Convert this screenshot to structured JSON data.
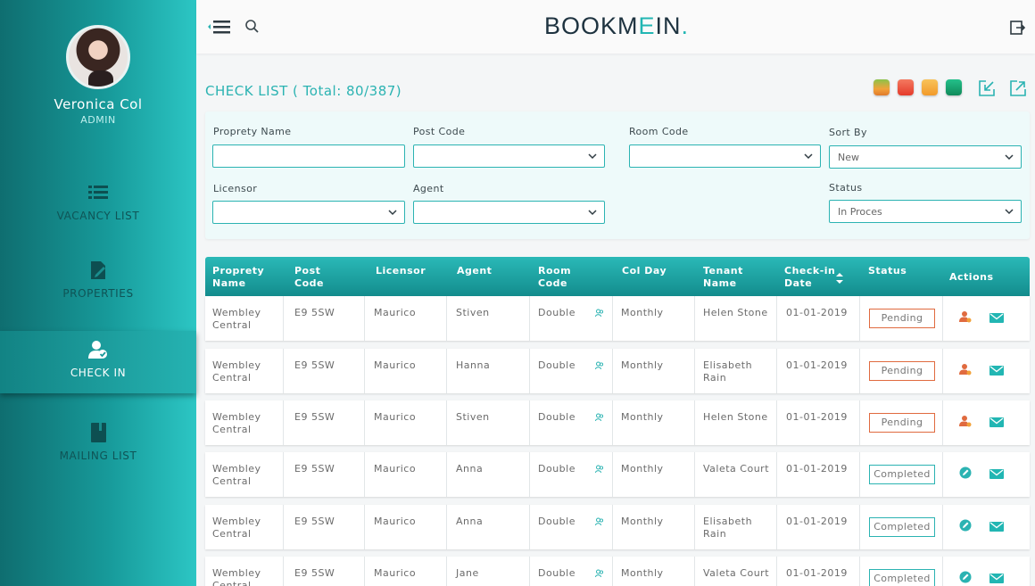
{
  "user": {
    "name": "Veronica Col",
    "role": "ADMIN"
  },
  "nav": [
    {
      "label": "VACANCY LIST",
      "icon": "list-icon"
    },
    {
      "label": "PROPERTIES",
      "icon": "edit-document-icon"
    },
    {
      "label": "CHECK IN",
      "icon": "user-check-icon",
      "active": true
    },
    {
      "label": "MAILING LIST",
      "icon": "book-icon"
    }
  ],
  "brand": {
    "prefix": "BOOKM",
    "accent": "E",
    "suffix": "IN",
    "dot": "."
  },
  "page": {
    "title": "CHECK LIST ( Total: 80/387)"
  },
  "color_filters": [
    "#f2a23a",
    "#f0533a",
    "#f5a93d",
    "#1aa57c"
  ],
  "colors": {
    "accent": "#2bb3b2",
    "pending": "#e06a3f",
    "mail": "#22b6b3",
    "sidebar_dark": "#0f6e70"
  },
  "filters": {
    "property_name": {
      "label": "Proprety Name",
      "value": ""
    },
    "post_code": {
      "label": "Post Code",
      "value": ""
    },
    "room_code": {
      "label": "Room Code",
      "value": ""
    },
    "sort_by": {
      "label": "Sort By",
      "value": "New"
    },
    "licensor": {
      "label": "Licensor",
      "value": ""
    },
    "agent": {
      "label": "Agent",
      "value": ""
    },
    "status": {
      "label": "Status",
      "value": "In Proces"
    }
  },
  "table": {
    "headers": [
      "Proprety\nName",
      "Post\nCode",
      "Licensor",
      "Agent",
      "Room\nCode",
      "Col Day",
      "Tenant\nName",
      "Check-in\nDate",
      "Status",
      "Actions"
    ],
    "rows": [
      {
        "property": "Wembley\nCentral",
        "post_code": "E9 5SW",
        "licensor": "Maurico",
        "agent": "Stiven",
        "room": "Double",
        "col_day": "Monthly",
        "tenant": "Helen Stone",
        "date": "01-01-2019",
        "status": "Pending"
      },
      {
        "property": "Wembley\nCentral",
        "post_code": "E9 5SW",
        "licensor": "Maurico",
        "agent": "Hanna",
        "room": "Double",
        "col_day": "Monthly",
        "tenant": "Elisabeth\nRain",
        "date": "01-01-2019",
        "status": "Pending"
      },
      {
        "property": "Wembley\nCentral",
        "post_code": "E9 5SW",
        "licensor": "Maurico",
        "agent": "Stiven",
        "room": "Double",
        "col_day": "Monthly",
        "tenant": "Helen Stone",
        "date": "01-01-2019",
        "status": "Pending"
      },
      {
        "property": "Wembley\nCentral",
        "post_code": "E9 5SW",
        "licensor": "Maurico",
        "agent": "Anna",
        "room": "Double",
        "col_day": "Monthly",
        "tenant": "Valeta Court",
        "date": "01-01-2019",
        "status": "Completed"
      },
      {
        "property": "Wembley\nCentral",
        "post_code": "E9 5SW",
        "licensor": "Maurico",
        "agent": "Anna",
        "room": "Double",
        "col_day": "Monthly",
        "tenant": "Elisabeth\nRain",
        "date": "01-01-2019",
        "status": "Completed"
      },
      {
        "property": "Wembley\nCentral",
        "post_code": "E9 5SW",
        "licensor": "Maurico",
        "agent": "Jane",
        "room": "Double",
        "col_day": "Monthly",
        "tenant": "Valeta Court",
        "date": "01-01-2019",
        "status": "Completed"
      }
    ]
  }
}
